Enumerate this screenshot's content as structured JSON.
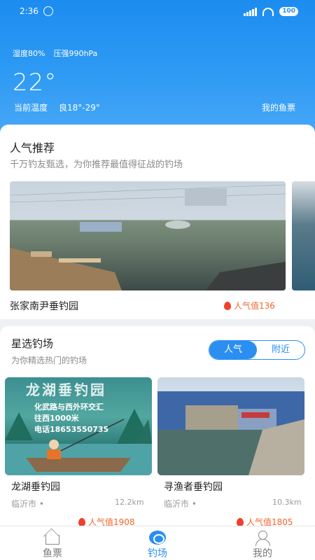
{
  "status_bar": {
    "time": "2:36",
    "battery": "100"
  },
  "weather": {
    "humidity": "湿度80%",
    "pressure": "压强990hPa",
    "temperature": "22°",
    "temp_label": "当前温度",
    "quality": "良18°-29°",
    "my_ticket": "我的鱼票"
  },
  "popular": {
    "title": "人气推荐",
    "subtitle": "千万钓友甄选，为你推荐最值得征战的钓场",
    "item": {
      "name": "张家南尹垂钓园",
      "popularity": "人气值136"
    }
  },
  "featured": {
    "title": "星选钓场",
    "subtitle": "为你精选热门的钓场",
    "tabs": [
      "人气",
      "附近"
    ],
    "items": [
      {
        "name": "龙湖垂钓园",
        "city": "临沂市 •",
        "distance": "12.2km",
        "popularity": "人气值1908",
        "sign_title": "龙湖垂钓园",
        "sign_lines": [
          "化武路与西外环交汇",
          "往西1000米",
          "电话18653550735"
        ]
      },
      {
        "name": "寻渔者垂钓园",
        "city": "临沂市 •",
        "distance": "10.3km",
        "popularity": "人气值1805"
      }
    ]
  },
  "nav": {
    "items": [
      "鱼票",
      "钓场",
      "我的"
    ]
  },
  "colors": {
    "accent": "#2a8ff0",
    "hot": "#f0662b"
  }
}
